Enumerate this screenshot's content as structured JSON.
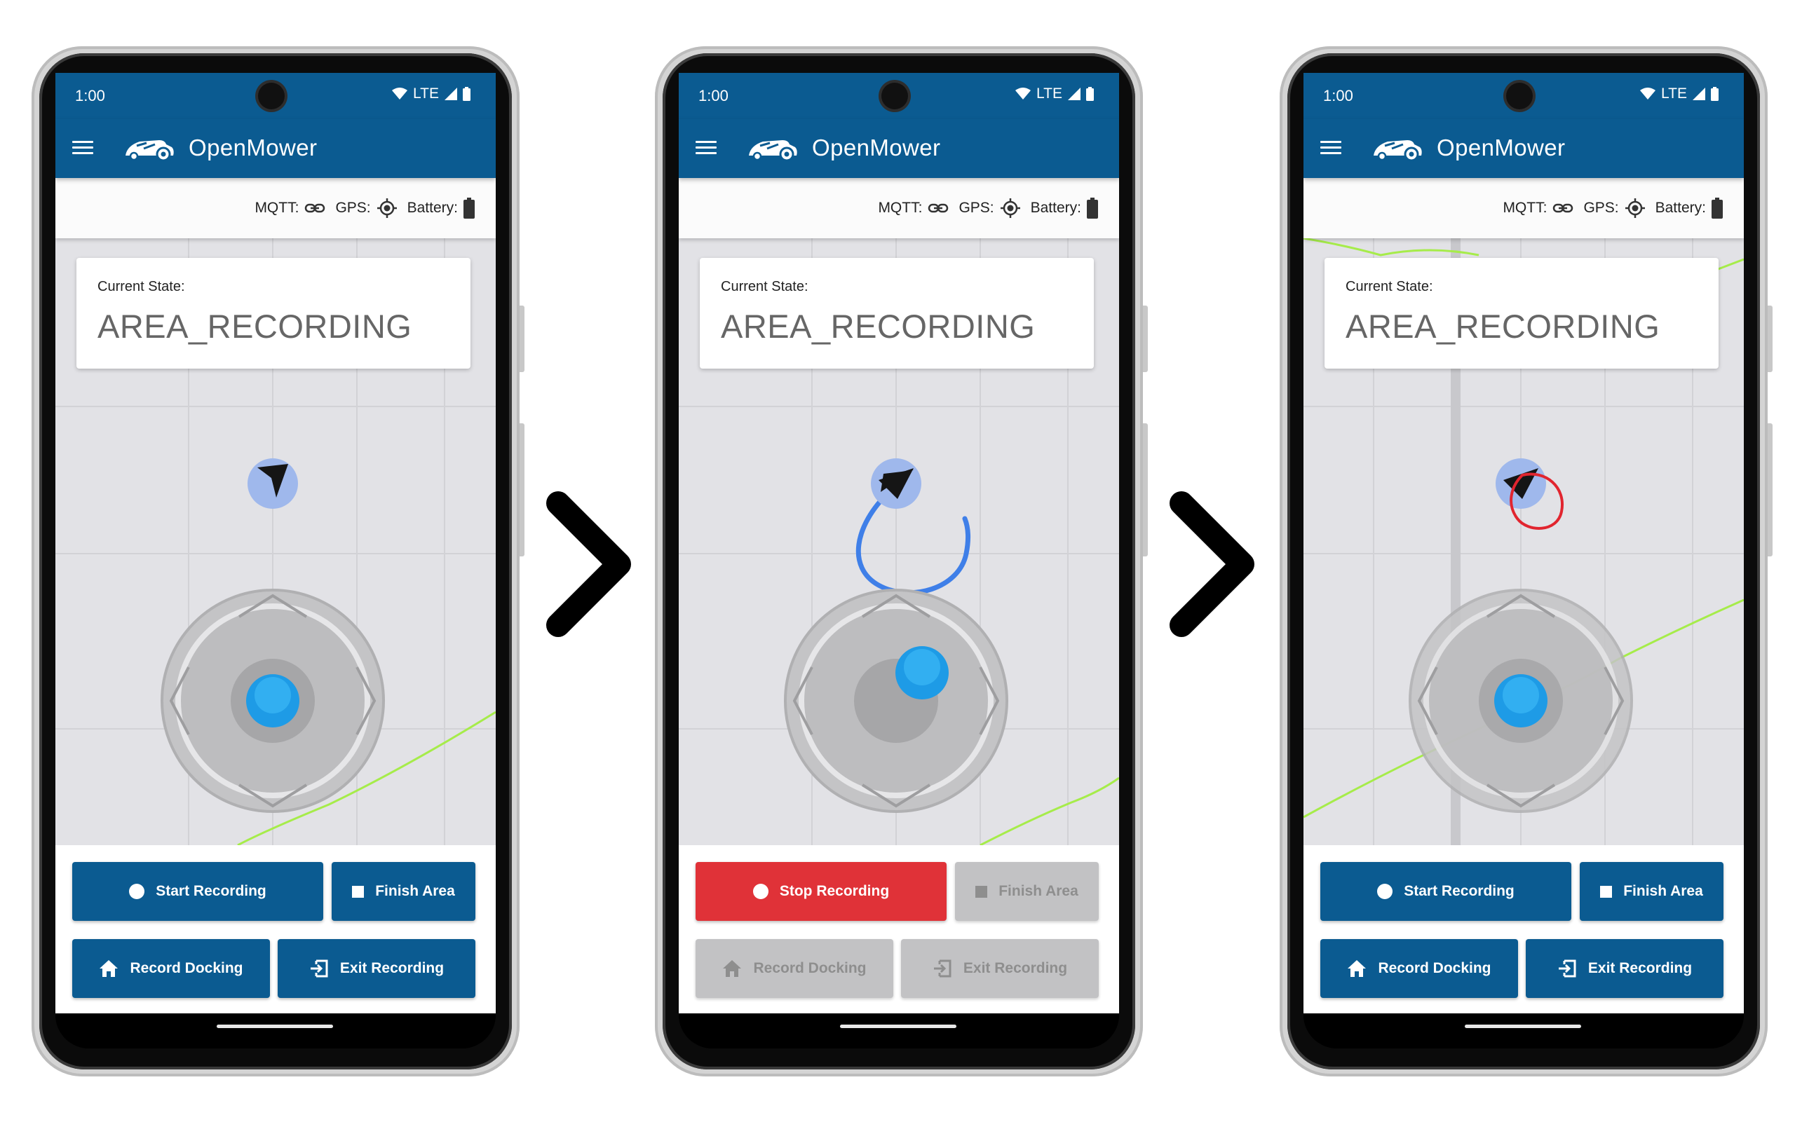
{
  "statusbar": {
    "time": "1:00",
    "network": "LTE"
  },
  "app": {
    "title": "OpenMower"
  },
  "infobar": {
    "mqtt": "MQTT:",
    "gps": "GPS:",
    "battery": "Battery:"
  },
  "state": {
    "label": "Current State:",
    "value": "AREA_RECORDING"
  },
  "buttons": {
    "start": "Start Recording",
    "stop": "Stop Recording",
    "finish": "Finish Area",
    "dock": "Record Docking",
    "exit": "Exit Recording"
  },
  "colors": {
    "primary": "#0b5b91",
    "stop": "#e03238",
    "disabled": "#c2c2c4",
    "path_blue": "#3f7fe8",
    "path_red": "#e1252f",
    "boundary_green": "#a6ec4a"
  },
  "screens": [
    {
      "step": 1,
      "recording": false,
      "drawn_path": "none"
    },
    {
      "step": 2,
      "recording": true,
      "drawn_path": "blue"
    },
    {
      "step": 3,
      "recording": false,
      "drawn_path": "red"
    }
  ],
  "icons": [
    "menu-icon",
    "mower-logo-icon",
    "link-icon",
    "gps-target-icon",
    "battery-icon",
    "wifi-icon",
    "signal-icon",
    "home-icon",
    "exit-icon",
    "chevron-right-icon"
  ]
}
